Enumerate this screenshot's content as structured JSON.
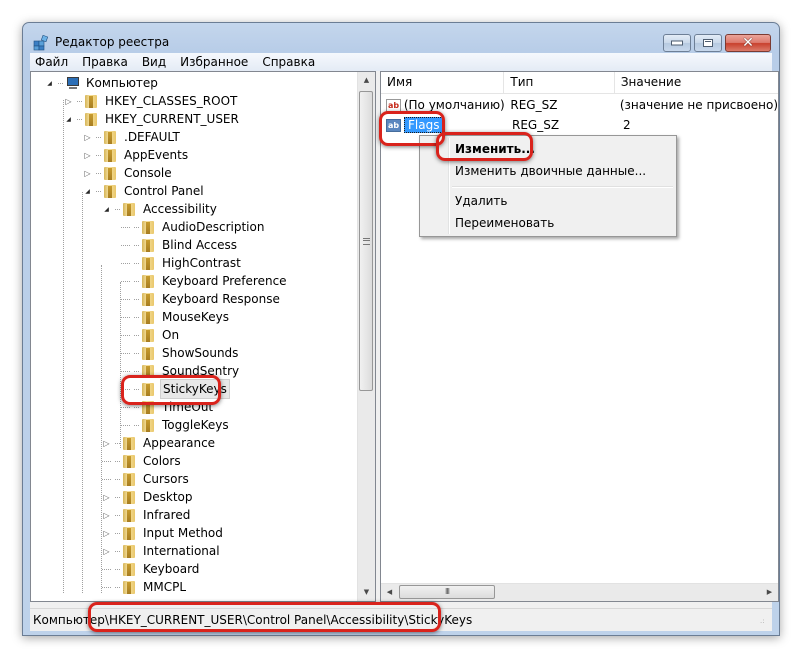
{
  "window": {
    "title": "Редактор реестра",
    "buttons": {
      "minimize": "minimize",
      "maximize": "maximize",
      "close": "close"
    }
  },
  "menubar": [
    "Файл",
    "Правка",
    "Вид",
    "Избранное",
    "Справка"
  ],
  "tree": {
    "root": "Компьютер",
    "items": [
      {
        "label": "HKEY_CLASSES_ROOT",
        "level": 1,
        "state": "collapsed"
      },
      {
        "label": "HKEY_CURRENT_USER",
        "level": 1,
        "state": "expanded"
      },
      {
        "label": ".DEFAULT",
        "level": 2,
        "state": "collapsed"
      },
      {
        "label": "AppEvents",
        "level": 2,
        "state": "collapsed"
      },
      {
        "label": "Console",
        "level": 2,
        "state": "collapsed"
      },
      {
        "label": "Control Panel",
        "level": 2,
        "state": "expanded"
      },
      {
        "label": "Accessibility",
        "level": 3,
        "state": "expanded"
      },
      {
        "label": "AudioDescription",
        "level": 4,
        "state": "leaf"
      },
      {
        "label": "Blind Access",
        "level": 4,
        "state": "leaf"
      },
      {
        "label": "HighContrast",
        "level": 4,
        "state": "leaf"
      },
      {
        "label": "Keyboard Preference",
        "level": 4,
        "state": "leaf"
      },
      {
        "label": "Keyboard Response",
        "level": 4,
        "state": "leaf"
      },
      {
        "label": "MouseKeys",
        "level": 4,
        "state": "leaf"
      },
      {
        "label": "On",
        "level": 4,
        "state": "leaf"
      },
      {
        "label": "ShowSounds",
        "level": 4,
        "state": "leaf"
      },
      {
        "label": "SoundSentry",
        "level": 4,
        "state": "leaf"
      },
      {
        "label": "StickyKeys",
        "level": 4,
        "state": "leaf",
        "selected": true
      },
      {
        "label": "TimeOut",
        "level": 4,
        "state": "leaf"
      },
      {
        "label": "ToggleKeys",
        "level": 4,
        "state": "leaf"
      },
      {
        "label": "Appearance",
        "level": 3,
        "state": "collapsed"
      },
      {
        "label": "Colors",
        "level": 3,
        "state": "leaf"
      },
      {
        "label": "Cursors",
        "level": 3,
        "state": "leaf"
      },
      {
        "label": "Desktop",
        "level": 3,
        "state": "collapsed"
      },
      {
        "label": "Infrared",
        "level": 3,
        "state": "collapsed"
      },
      {
        "label": "Input Method",
        "level": 3,
        "state": "collapsed"
      },
      {
        "label": "International",
        "level": 3,
        "state": "collapsed"
      },
      {
        "label": "Keyboard",
        "level": 3,
        "state": "leaf"
      },
      {
        "label": "MMCPL",
        "level": 3,
        "state": "leaf"
      }
    ]
  },
  "list": {
    "columns": [
      "Имя",
      "Тип",
      "Значение"
    ],
    "rows": [
      {
        "icon": "ab",
        "name": "(По умолчанию)",
        "type": "REG_SZ",
        "value": "(значение не присвоено)"
      },
      {
        "icon": "ab",
        "name": "Flags",
        "type": "REG_SZ",
        "value": "2",
        "selected": true
      }
    ]
  },
  "context_menu": {
    "items": [
      {
        "label": "Изменить...",
        "bold": true
      },
      {
        "label": "Изменить двоичные данные..."
      },
      {
        "separator": true
      },
      {
        "label": "Удалить"
      },
      {
        "label": "Переименовать"
      }
    ]
  },
  "statusbar": {
    "path": "Компьютер\\HKEY_CURRENT_USER\\Control Panel\\Accessibility\\StickyKeys"
  },
  "hscroll_grip": "III"
}
